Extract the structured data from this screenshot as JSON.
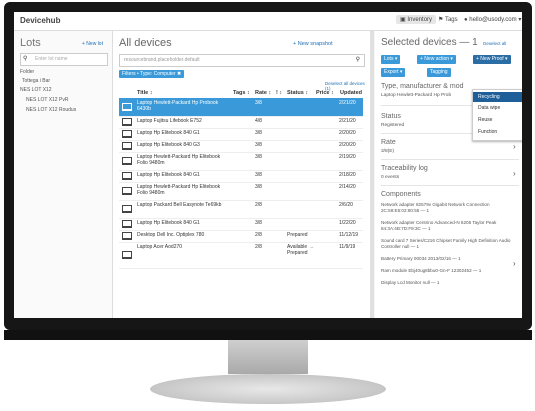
{
  "header": {
    "logo": "Devicehub",
    "inventory": "Inventory",
    "tags": "Tags",
    "user": "hello@usody.com"
  },
  "lots": {
    "title": "Lots",
    "new_label": "+ New lot",
    "search_placeholder": "Enter lot name",
    "items": [
      "Folder",
      "Tottega i Bar",
      "NES LOT X12",
      "NES LOT X12 PvR",
      "NES LOT X12 Roudus"
    ]
  },
  "devices": {
    "title": "All devices",
    "snapshot": "+ New snapshot",
    "search_placeholder": "resourcebrand.placeholder.default",
    "filter_chip": "Filters •  Type: Computer ✖",
    "deselect_all": "Deselect all devices (1)",
    "columns": [
      "Title ↕",
      "Tags ↕",
      "Rate ↕",
      "! ↕",
      "Status ↕",
      "Price ↕",
      "Updated"
    ],
    "rows": [
      {
        "title": "Laptop Hewlett-Packard Hp Probook 6430b",
        "rate": "3/8",
        "status": "",
        "updated": "2/21/20",
        "selected": true
      },
      {
        "title": "Laptop Fujitsu Lifebook E752",
        "rate": "4/8",
        "status": "",
        "updated": "2/21/20",
        "selected": false
      },
      {
        "title": "Laptop Hp Elitebook 840 G1",
        "rate": "3/8",
        "status": "",
        "updated": "2/20/20",
        "selected": false
      },
      {
        "title": "Laptop Hp Elitebook 840 G3",
        "rate": "3/8",
        "status": "",
        "updated": "2/20/20",
        "selected": false
      },
      {
        "title": "Laptop Hewlett-Packard Hp Elitebook Folio 9480m",
        "rate": "3/8",
        "status": "",
        "updated": "2/19/20",
        "selected": false
      },
      {
        "title": "Laptop Hp Elitebook 840 G1",
        "rate": "3/8",
        "status": "",
        "updated": "2/18/20",
        "selected": false
      },
      {
        "title": "Laptop Hewlett-Packard Hp Elitebook Folio 9480m",
        "rate": "3/8",
        "status": "",
        "updated": "2/14/20",
        "selected": false
      },
      {
        "title": "Laptop Packard Bell Easynote Te69kb",
        "rate": "2/8",
        "status": "",
        "updated": "2/6/20",
        "selected": false
      },
      {
        "title": "Laptop Hp Elitebook 840 G1",
        "rate": "3/8",
        "status": "",
        "updated": "1/22/20",
        "selected": false
      },
      {
        "title": "Desktop Dell Inc. Optiplex 780",
        "rate": "2/8",
        "status": "Prepared",
        "updated": "11/12/19",
        "selected": false
      },
      {
        "title": "Laptop Acer Aod270",
        "rate": "2/8",
        "status": "Available → Prepared",
        "updated": "11/9/19",
        "selected": false
      }
    ]
  },
  "selected": {
    "title": "Selected devices — 1",
    "deselect": "Deselect all",
    "buttons": [
      "Lots ▾",
      "+ New action ▾",
      "+ New Proof ▾"
    ],
    "buttons2": [
      "Export ▾",
      "Tagging"
    ],
    "type_label": "Type, manufacturer & mod",
    "type_value": "Laptop Hewlett-Packard Hp Prob",
    "status_label": "Status",
    "status_value": "Registered",
    "rate_label": "Rate",
    "rate_value": "3/8(E)",
    "trace_label": "Traceability log",
    "trace_value": "0 events",
    "components_label": "Components",
    "components": [
      "Network adapter 82579v Gigabit Network Connection 2C:59:E5:02:80:55 — 1",
      "Network adapter Centrino Advanced-N 6205 Taylor Peak 84:3A:4B:7D:F9:3C — 1",
      "Sound card 7 Series/C216 Chipset Family High Definition Audio Controller null — 1",
      "Battery Primary 00034 2013/02/16 — 1",
      "Ram module Ebj40ug8bbu0-Gn-F 12302452 — 1",
      "Display Lcd Monitor null — 1"
    ]
  },
  "dropdown": {
    "items": [
      "Recycling",
      "Data wipe",
      "Reuse",
      "Function"
    ],
    "active": "Recycling"
  },
  "colors": {
    "accent": "#3a9ad9",
    "dark_accent": "#1e5f99",
    "bezel": "#161616"
  }
}
